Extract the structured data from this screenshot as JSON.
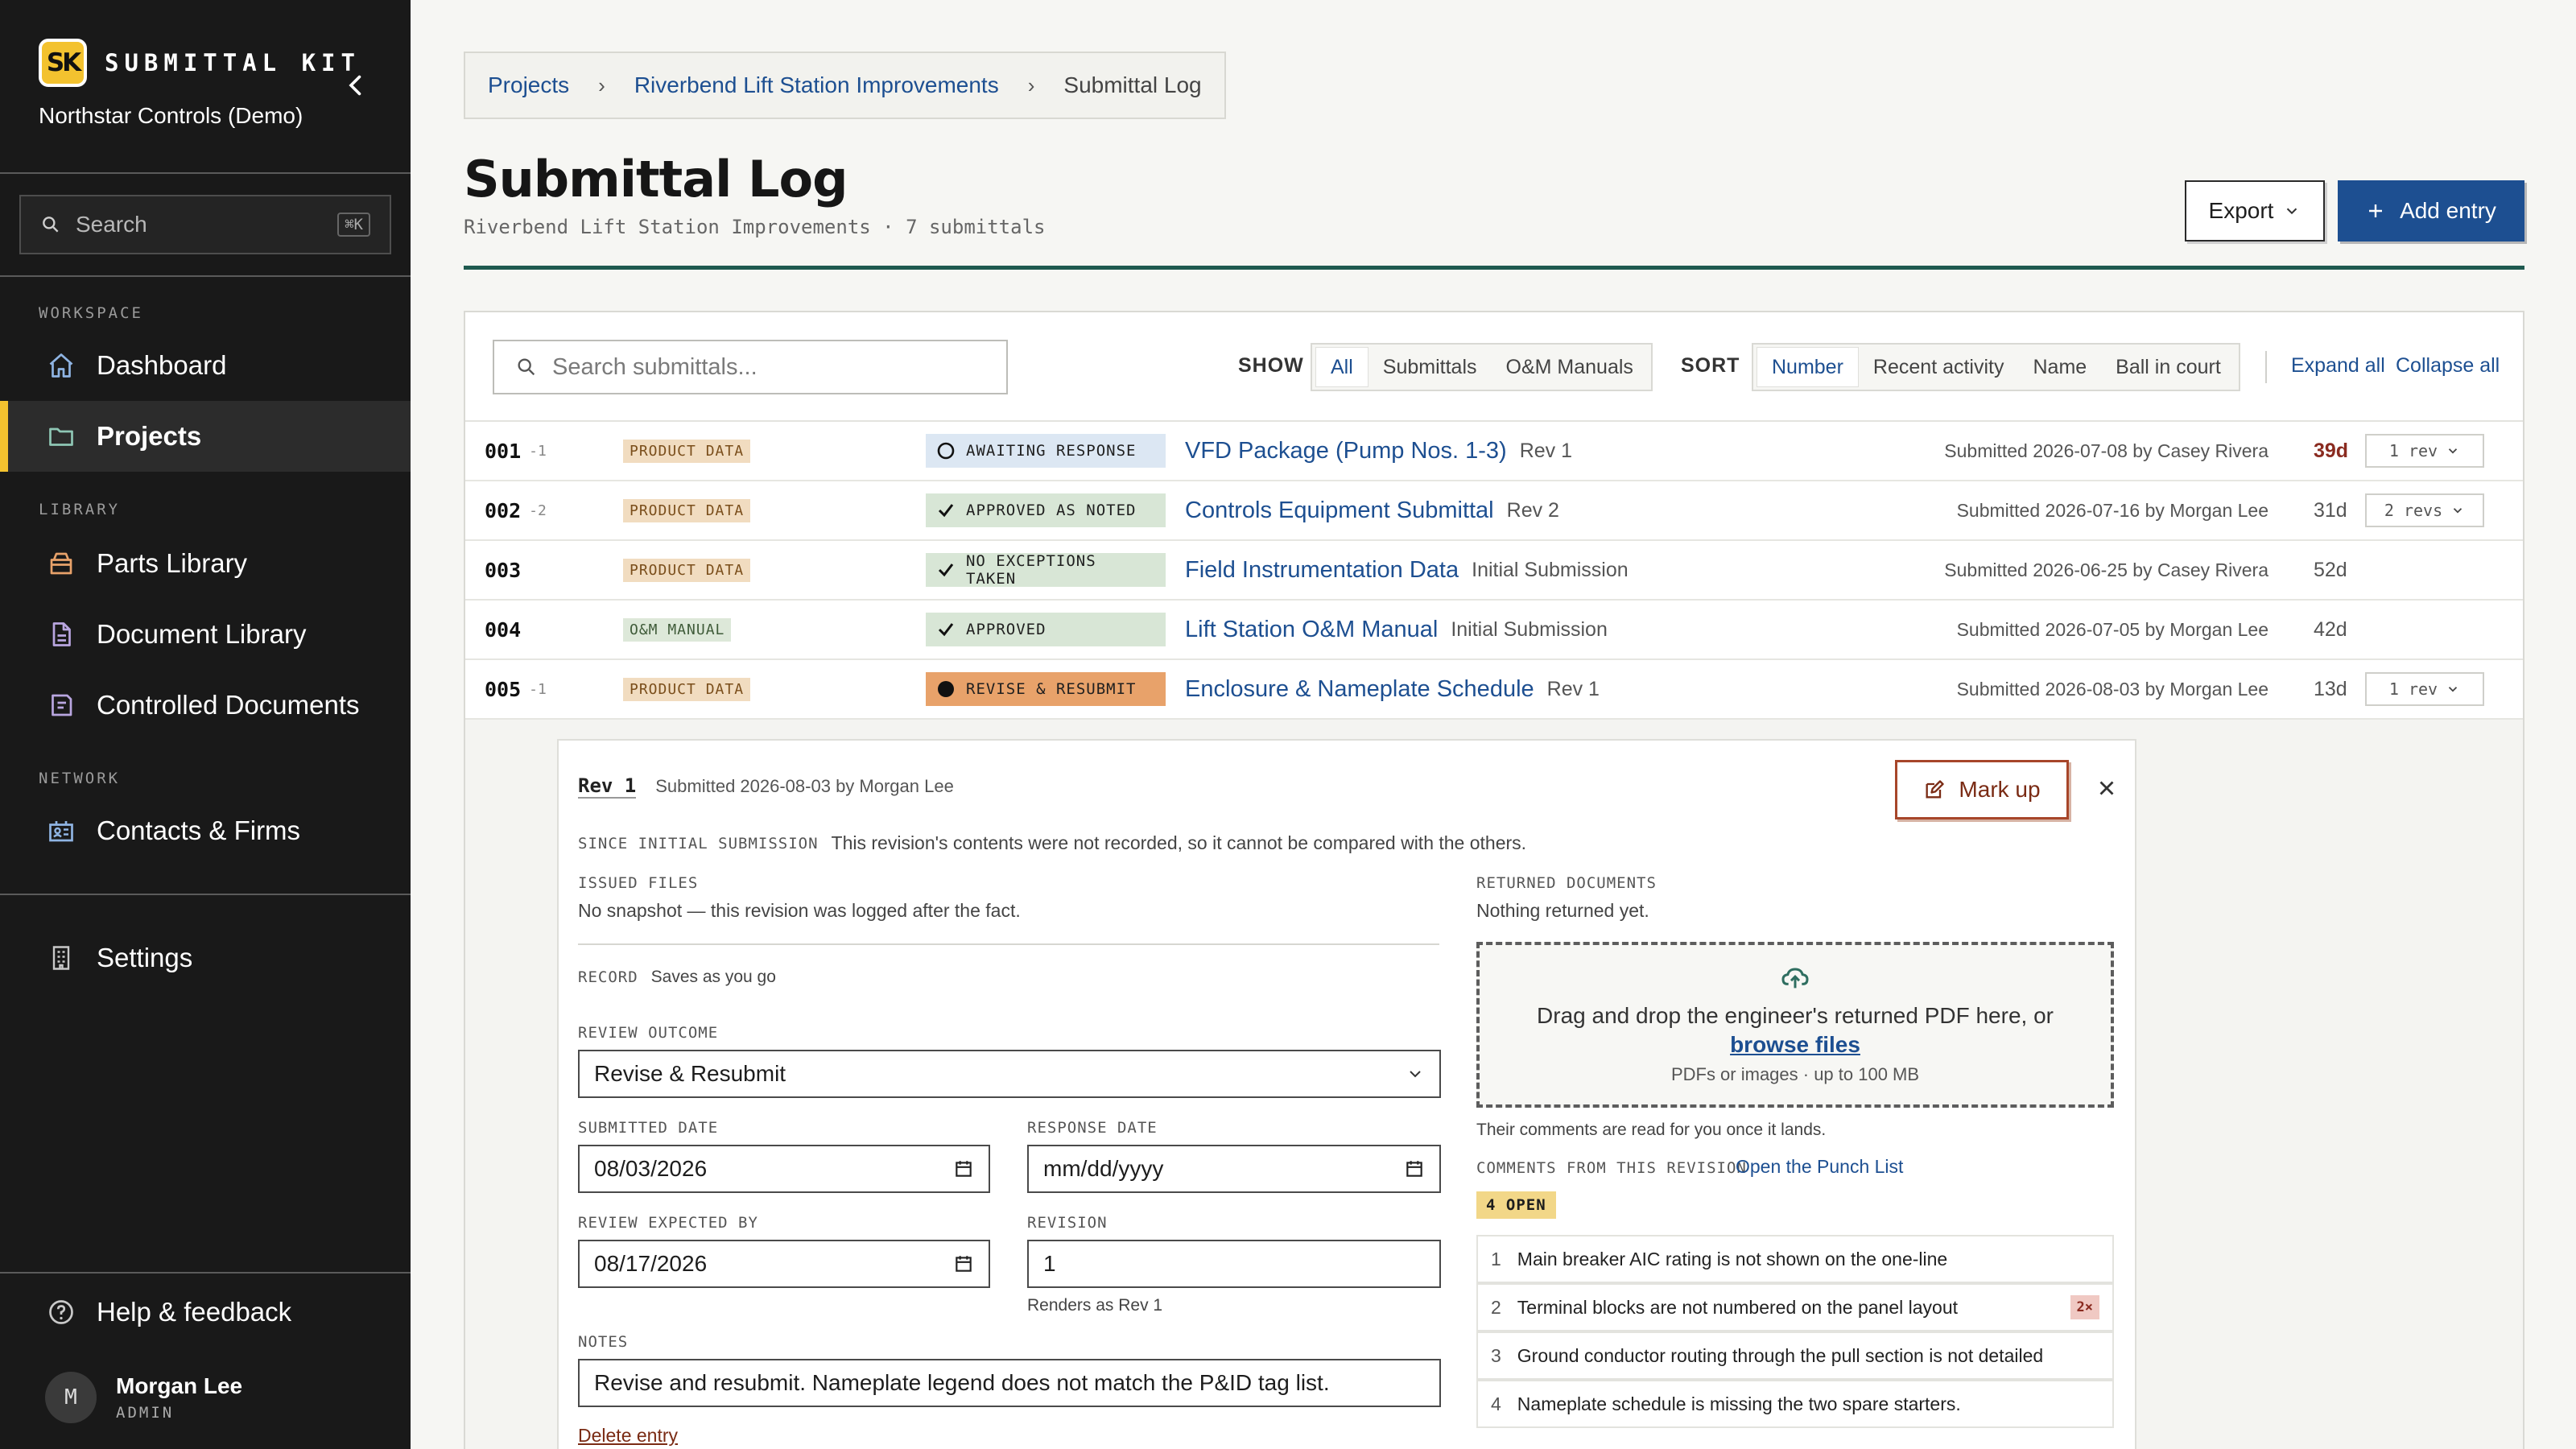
{
  "app": {
    "logo_text": "SK",
    "name": "SUBMITTAL KIT",
    "org": "Northstar Controls (Demo)"
  },
  "sidebar": {
    "search_placeholder": "Search",
    "search_shortcut": "⌘K",
    "workspace_label": "WORKSPACE",
    "library_label": "LIBRARY",
    "network_label": "NETWORK",
    "items": [
      {
        "label": "Dashboard",
        "icon": "home-icon"
      },
      {
        "label": "Projects",
        "icon": "folder-icon",
        "active": true
      },
      {
        "label": "Parts Library",
        "icon": "box-icon"
      },
      {
        "label": "Document Library",
        "icon": "document-icon"
      },
      {
        "label": "Controlled Documents",
        "icon": "controlled-document-icon"
      },
      {
        "label": "Contacts & Firms",
        "icon": "contacts-icon"
      },
      {
        "label": "Settings",
        "icon": "building-icon"
      },
      {
        "label": "Help & feedback",
        "icon": "help-icon"
      }
    ],
    "user": {
      "initial": "M",
      "name": "Morgan Lee",
      "role": "ADMIN"
    }
  },
  "breadcrumb": [
    "Projects",
    "Riverbend Lift Station Improvements",
    "Submittal Log"
  ],
  "page": {
    "title": "Submittal Log",
    "subtitle": "Riverbend Lift Station Improvements · 7 submittals",
    "export_label": "Export",
    "add_label": "Add entry"
  },
  "toolbar": {
    "search_placeholder": "Search submittals...",
    "show_label": "SHOW",
    "show_options": [
      "All",
      "Submittals",
      "O&M Manuals"
    ],
    "show_selected": "All",
    "sort_label": "SORT",
    "sort_options": [
      "Number",
      "Recent activity",
      "Name",
      "Ball in court"
    ],
    "sort_selected": "Number",
    "expand_all": "Expand all",
    "collapse_all": "Collapse all"
  },
  "submittals": [
    {
      "number": "001",
      "rev_suffix": "-1",
      "type": "PRODUCT DATA",
      "status": "AWAITING RESPONSE",
      "status_kind": "await",
      "title": "VFD Package (Pump Nos. 1-3)",
      "revision": "Rev 1",
      "submitted": "Submitted 2026-07-08 by Casey Rivera",
      "age": "39d",
      "age_overdue": true,
      "rev_button": "1 rev"
    },
    {
      "number": "002",
      "rev_suffix": "-2",
      "type": "PRODUCT DATA",
      "status": "APPROVED AS NOTED",
      "status_kind": "green",
      "title": "Controls Equipment Submittal",
      "revision": "Rev 2",
      "submitted": "Submitted 2026-07-16 by Morgan Lee",
      "age": "31d",
      "age_overdue": false,
      "rev_button": "2 revs"
    },
    {
      "number": "003",
      "rev_suffix": "",
      "type": "PRODUCT DATA",
      "status": "NO EXCEPTIONS TAKEN",
      "status_kind": "green",
      "title": "Field Instrumentation Data",
      "revision": "Initial Submission",
      "submitted": "Submitted 2026-06-25 by Casey Rivera",
      "age": "52d",
      "age_overdue": false,
      "rev_button": ""
    },
    {
      "number": "004",
      "rev_suffix": "",
      "type": "O&M MANUAL",
      "status": "APPROVED",
      "status_kind": "green",
      "title": "Lift Station O&M Manual",
      "revision": "Initial Submission",
      "submitted": "Submitted 2026-07-05 by Morgan Lee",
      "age": "42d",
      "age_overdue": false,
      "rev_button": ""
    },
    {
      "number": "005",
      "rev_suffix": "-1",
      "type": "PRODUCT DATA",
      "status": "REVISE & RESUBMIT",
      "status_kind": "orange",
      "title": "Enclosure & Nameplate Schedule",
      "revision": "Rev 1",
      "submitted": "Submitted 2026-08-03 by Morgan Lee",
      "age": "13d",
      "age_overdue": false,
      "rev_button": "1 rev"
    }
  ],
  "detail": {
    "rev_label": "Rev 1",
    "submitted": "Submitted 2026-08-03 by Morgan Lee",
    "markup_label": "Mark up",
    "since_label": "SINCE INITIAL SUBMISSION",
    "since_text": "This revision's contents were not recorded, so it cannot be compared with the others.",
    "issued_label": "ISSUED FILES",
    "issued_text": "No snapshot — this revision was logged after the fact.",
    "record_label": "RECORD",
    "record_text": "Saves as you go",
    "outcome_label": "REVIEW OUTCOME",
    "outcome_value": "Revise & Resubmit",
    "submitted_date_label": "SUBMITTED DATE",
    "submitted_date_value": "08/03/2026",
    "response_date_label": "RESPONSE DATE",
    "response_date_value": "mm/dd/yyyy",
    "expected_label": "REVIEW EXPECTED BY",
    "expected_value": "08/17/2026",
    "revision_label": "REVISION",
    "revision_value": "1",
    "revision_hint": "Renders as Rev 1",
    "notes_label": "NOTES",
    "notes_value": "Revise and resubmit. Nameplate legend does not match the P&ID tag list.",
    "delete_label": "Delete entry",
    "returned_label": "RETURNED DOCUMENTS",
    "returned_text": "Nothing returned yet.",
    "drop_text": "Drag and drop the engineer's returned PDF here, or",
    "drop_link": "browse files",
    "drop_hint": "PDFs or images · up to 100 MB",
    "drop_note": "Their comments are read for you once it lands.",
    "comments_label": "COMMENTS FROM THIS REVISION",
    "punch_link": "Open the Punch List",
    "open_badge": "4 OPEN",
    "comments": [
      {
        "n": "1",
        "text": "Main breaker AIC rating is not shown on the one-line",
        "count": ""
      },
      {
        "n": "2",
        "text": "Terminal blocks are not numbered on the panel layout",
        "count": "2×"
      },
      {
        "n": "3",
        "text": "Ground conductor routing through the pull section is not detailed",
        "count": ""
      },
      {
        "n": "4",
        "text": "Nameplate schedule is missing the two spare starters.",
        "count": ""
      }
    ]
  },
  "colors": {
    "sidebar_bg": "#191919",
    "accent_yellow": "#f3c22f",
    "link_blue": "#1d4f91",
    "title_rule": "#1f5a4f",
    "revise_orange": "#e8a26a",
    "overdue_red": "#8a2b20"
  }
}
